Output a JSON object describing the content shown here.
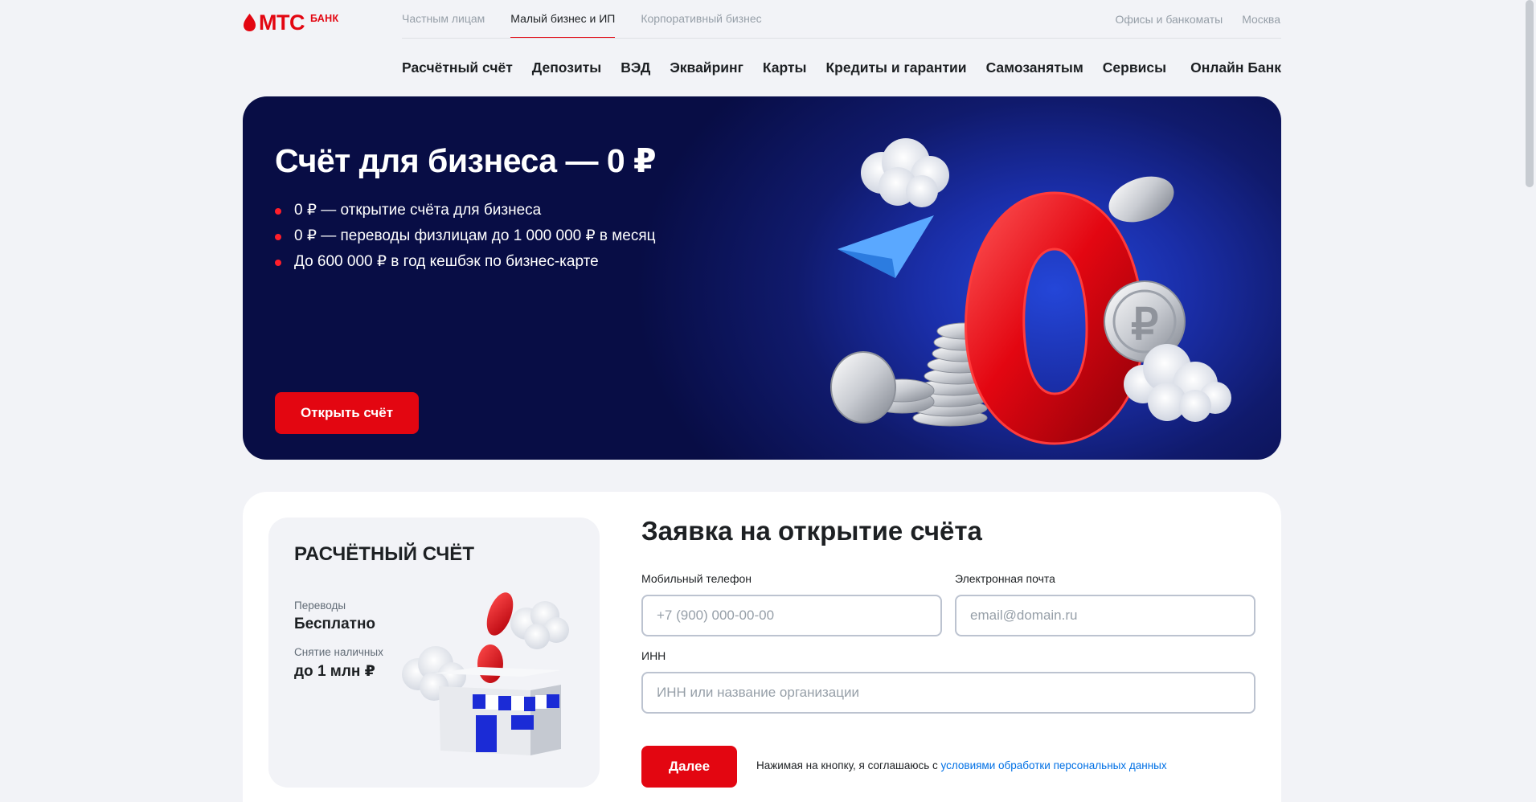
{
  "header": {
    "logo": {
      "brand": "МТС",
      "product": "БАНК"
    },
    "segments": [
      {
        "label": "Частным лицам",
        "active": false
      },
      {
        "label": "Малый бизнес и ИП",
        "active": true
      },
      {
        "label": "Корпоративный бизнес",
        "active": false
      }
    ],
    "top_links": {
      "offices": "Офисы и банкоматы",
      "city": "Москва"
    },
    "nav": [
      "Расчётный счёт",
      "Депозиты",
      "ВЭД",
      "Эквайринг",
      "Карты",
      "Кредиты и гарантии",
      "Самозанятым",
      "Сервисы"
    ],
    "online_bank": "Онлайн Банк"
  },
  "hero": {
    "title": "Счёт для бизнеса — 0 ₽",
    "bullets": [
      "0 ₽ — открытие счёта для бизнеса",
      "0 ₽ — переводы физлицам до 1 000 000 ₽ в месяц",
      "До 600 000 ₽ в год кешбэк по бизнес-карте"
    ],
    "button": "Открыть счёт",
    "art_digit": "0"
  },
  "account_card": {
    "title": "РАСЧЁТНЫЙ СЧЁТ",
    "transfers_label": "Переводы",
    "transfers_value": "Бесплатно",
    "cash_label": "Снятие наличных",
    "cash_value": "до 1 млн ₽"
  },
  "form": {
    "title": "Заявка на открытие счёта",
    "phone": {
      "label": "Мобильный телефон",
      "placeholder": "+7 (900) 000-00-00",
      "value": ""
    },
    "email": {
      "label": "Электронная почта",
      "placeholder": "email@domain.ru",
      "value": ""
    },
    "inn": {
      "label": "ИНН",
      "placeholder": "ИНН или название организации",
      "value": ""
    },
    "submit": "Далее",
    "consent_text": "Нажимая на кнопку, я соглашаюсь с ",
    "consent_link": "условиями обработки персональных данных"
  },
  "colors": {
    "brand_red": "#e30611",
    "hero_dark": "#080d45",
    "hero_glow": "#2446d8",
    "link_blue": "#0070e5"
  }
}
